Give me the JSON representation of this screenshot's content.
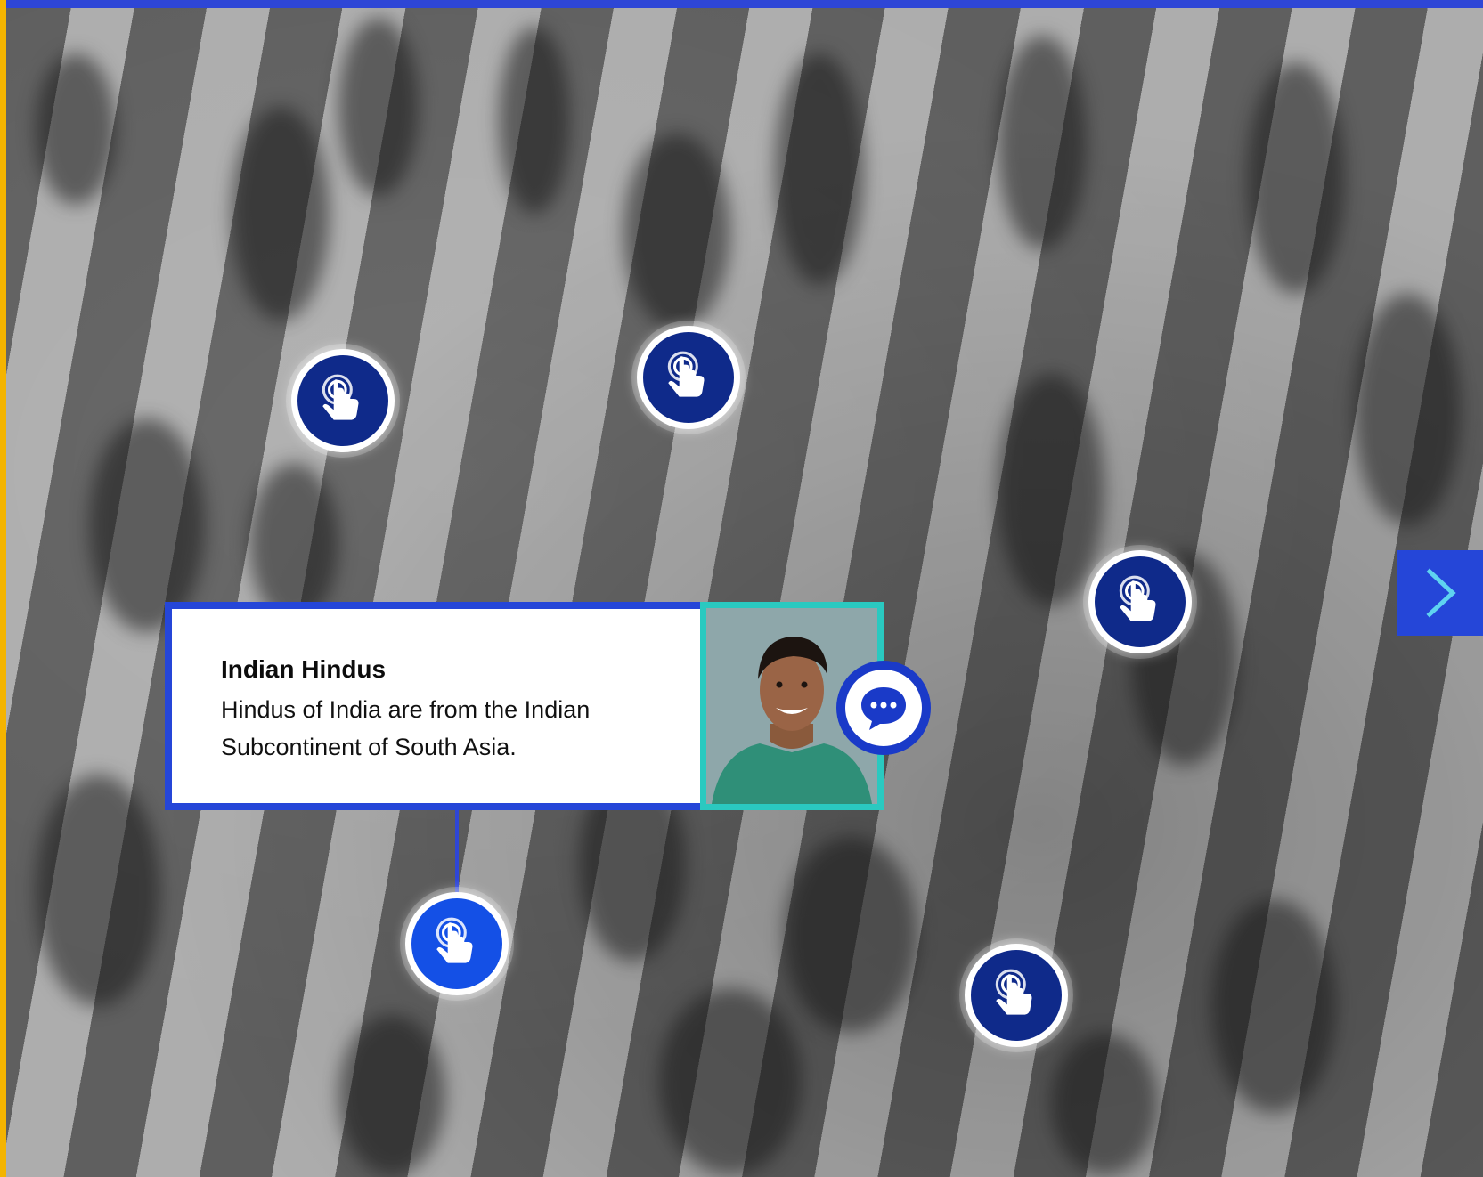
{
  "colors": {
    "accent_blue": "#2546d8",
    "hotspot_dark": "#0f2a8a",
    "hotspot_active": "#1450e6",
    "portrait_border": "#2ac9c0",
    "left_strip": "#f4b400"
  },
  "background": {
    "image": "black-and-white crowd of pedestrians on a zebra crossing"
  },
  "hotspots": [
    {
      "icon": "touch-icon",
      "state": "default"
    },
    {
      "icon": "touch-icon",
      "state": "default"
    },
    {
      "icon": "touch-icon",
      "state": "default"
    },
    {
      "icon": "touch-icon",
      "state": "active"
    },
    {
      "icon": "touch-icon",
      "state": "default"
    }
  ],
  "info_card": {
    "title": "Indian Hindus",
    "text": "Hindus of India are from the Indian Subcontinent of South Asia.",
    "portrait": "smiling young man in green t-shirt",
    "chat_icon": "chat-bubble-icon"
  },
  "navigation": {
    "next_icon": "chevron-right-icon"
  }
}
